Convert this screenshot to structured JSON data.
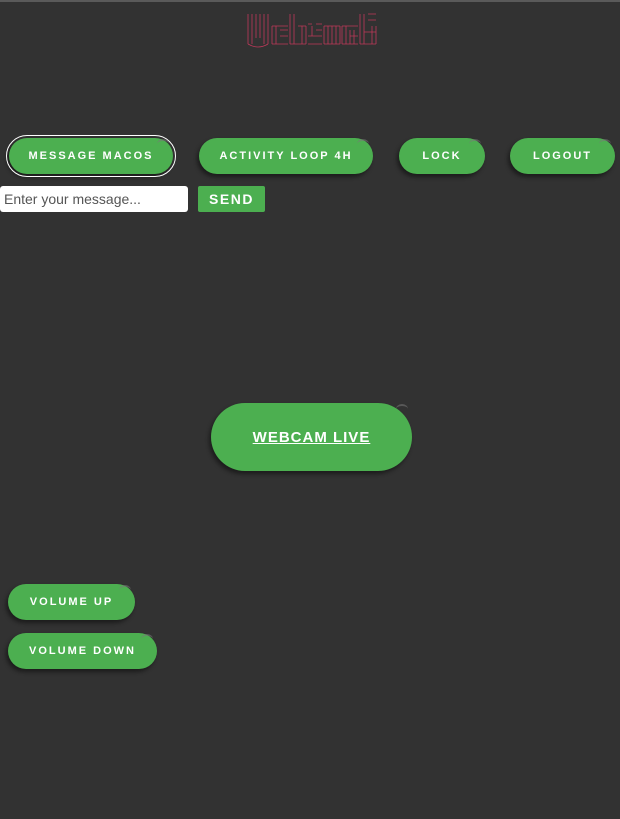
{
  "header": {
    "logo_icon": "ascii-art-logo-icon",
    "logo_color": "#c0395a"
  },
  "controls": {
    "message_macos": "MESSAGE MACOS",
    "activity_loop": "ACTIVITY LOOP 4H",
    "lock": "LOCK",
    "logout": "LOGOUT"
  },
  "message": {
    "placeholder": "Enter your message...",
    "send_label": "SEND"
  },
  "webcam": {
    "label": "WEBCAM LIVE"
  },
  "volume": {
    "up_label": "VOLUME UP",
    "down_label": "VOLUME DOWN"
  },
  "colors": {
    "background": "#323232",
    "accent": "#4caf50"
  }
}
